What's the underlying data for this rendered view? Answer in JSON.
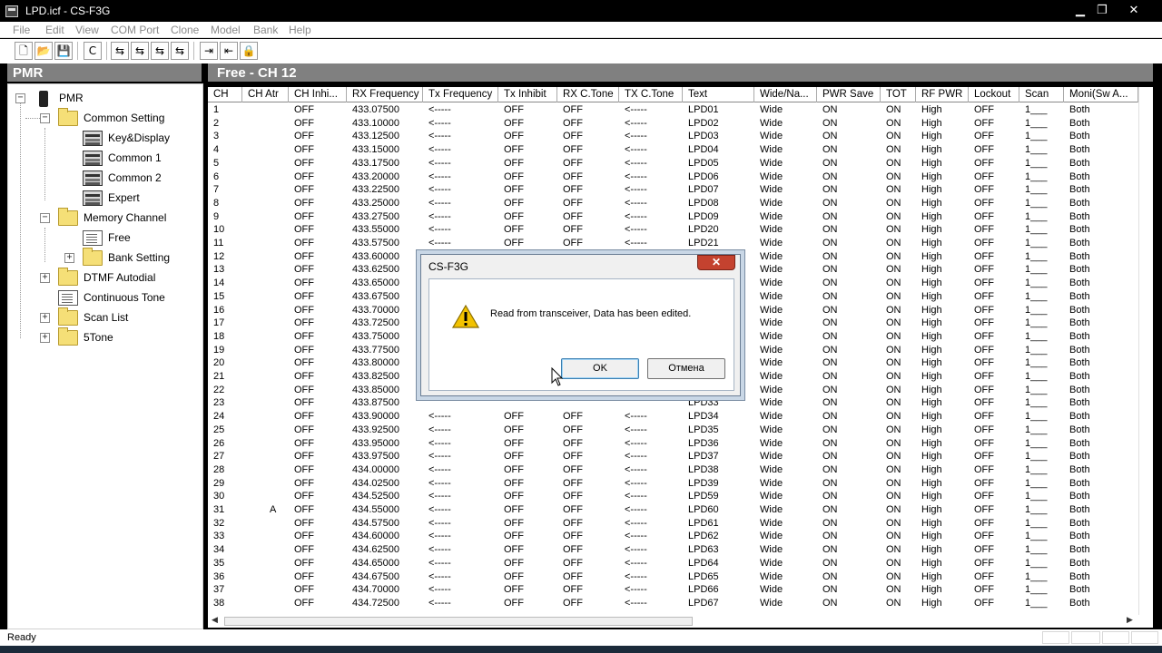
{
  "window": {
    "title": "LPD.icf - CS-F3G",
    "minimize": "▁",
    "maximize": "❐",
    "close": "✕"
  },
  "menu": [
    "File",
    "Edit",
    "View",
    "COM Port",
    "Clone",
    "Model",
    "Bank",
    "Help"
  ],
  "left_panel": {
    "header": "PMR",
    "tree": [
      {
        "label": "PMR",
        "icon": "radio-icon"
      },
      {
        "label": "Common Setting",
        "icon": "folder-icon",
        "expander": "−"
      },
      {
        "label": "Key&Display",
        "icon": "screen-icon"
      },
      {
        "label": "Common 1",
        "icon": "screen-icon"
      },
      {
        "label": "Common 2",
        "icon": "screen-icon"
      },
      {
        "label": "Expert",
        "icon": "screen-icon"
      },
      {
        "label": "Memory Channel",
        "icon": "folder-icon",
        "expander": "−"
      },
      {
        "label": "Free",
        "icon": "document-icon"
      },
      {
        "label": "Bank Setting",
        "icon": "folder-icon",
        "expander": "+"
      },
      {
        "label": "DTMF Autodial",
        "icon": "folder-icon",
        "expander": "+"
      },
      {
        "label": "Continuous Tone",
        "icon": "document-icon"
      },
      {
        "label": "Scan List",
        "icon": "folder-icon",
        "expander": "+"
      },
      {
        "label": "5Tone",
        "icon": "folder-icon",
        "expander": "+"
      }
    ]
  },
  "main": {
    "header": "Free - CH 12",
    "columns": [
      "CH",
      "CH Atr",
      "CH Inhi...",
      "RX Frequency",
      "Tx Frequency",
      "Tx Inhibit",
      "RX C.Tone",
      "TX C.Tone",
      "Text",
      "Wide/Na...",
      "PWR Save",
      "TOT",
      "RF PWR",
      "Lockout",
      "Scan",
      "Moni(Sw A..."
    ],
    "rows": [
      [
        "1",
        "",
        "OFF",
        "433.07500",
        "<-----",
        "OFF",
        "OFF",
        "<-----",
        "LPD01",
        "Wide",
        "ON",
        "ON",
        "High",
        "OFF",
        "1___",
        "Both"
      ],
      [
        "2",
        "",
        "OFF",
        "433.10000",
        "<-----",
        "OFF",
        "OFF",
        "<-----",
        "LPD02",
        "Wide",
        "ON",
        "ON",
        "High",
        "OFF",
        "1___",
        "Both"
      ],
      [
        "3",
        "",
        "OFF",
        "433.12500",
        "<-----",
        "OFF",
        "OFF",
        "<-----",
        "LPD03",
        "Wide",
        "ON",
        "ON",
        "High",
        "OFF",
        "1___",
        "Both"
      ],
      [
        "4",
        "",
        "OFF",
        "433.15000",
        "<-----",
        "OFF",
        "OFF",
        "<-----",
        "LPD04",
        "Wide",
        "ON",
        "ON",
        "High",
        "OFF",
        "1___",
        "Both"
      ],
      [
        "5",
        "",
        "OFF",
        "433.17500",
        "<-----",
        "OFF",
        "OFF",
        "<-----",
        "LPD05",
        "Wide",
        "ON",
        "ON",
        "High",
        "OFF",
        "1___",
        "Both"
      ],
      [
        "6",
        "",
        "OFF",
        "433.20000",
        "<-----",
        "OFF",
        "OFF",
        "<-----",
        "LPD06",
        "Wide",
        "ON",
        "ON",
        "High",
        "OFF",
        "1___",
        "Both"
      ],
      [
        "7",
        "",
        "OFF",
        "433.22500",
        "<-----",
        "OFF",
        "OFF",
        "<-----",
        "LPD07",
        "Wide",
        "ON",
        "ON",
        "High",
        "OFF",
        "1___",
        "Both"
      ],
      [
        "8",
        "",
        "OFF",
        "433.25000",
        "<-----",
        "OFF",
        "OFF",
        "<-----",
        "LPD08",
        "Wide",
        "ON",
        "ON",
        "High",
        "OFF",
        "1___",
        "Both"
      ],
      [
        "9",
        "",
        "OFF",
        "433.27500",
        "<-----",
        "OFF",
        "OFF",
        "<-----",
        "LPD09",
        "Wide",
        "ON",
        "ON",
        "High",
        "OFF",
        "1___",
        "Both"
      ],
      [
        "10",
        "",
        "OFF",
        "433.55000",
        "<-----",
        "OFF",
        "OFF",
        "<-----",
        "LPD20",
        "Wide",
        "ON",
        "ON",
        "High",
        "OFF",
        "1___",
        "Both"
      ],
      [
        "11",
        "",
        "OFF",
        "433.57500",
        "<-----",
        "OFF",
        "OFF",
        "<-----",
        "LPD21",
        "Wide",
        "ON",
        "ON",
        "High",
        "OFF",
        "1___",
        "Both"
      ],
      [
        "12",
        "",
        "OFF",
        "433.60000",
        "",
        "",
        "",
        "",
        "",
        "Wide",
        "ON",
        "ON",
        "High",
        "OFF",
        "1___",
        "Both"
      ],
      [
        "13",
        "",
        "OFF",
        "433.62500",
        "",
        "",
        "",
        "",
        "",
        "Wide",
        "ON",
        "ON",
        "High",
        "OFF",
        "1___",
        "Both"
      ],
      [
        "14",
        "",
        "OFF",
        "433.65000",
        "",
        "",
        "",
        "",
        "",
        "Wide",
        "ON",
        "ON",
        "High",
        "OFF",
        "1___",
        "Both"
      ],
      [
        "15",
        "",
        "OFF",
        "433.67500",
        "",
        "",
        "",
        "",
        "",
        "Wide",
        "ON",
        "ON",
        "High",
        "OFF",
        "1___",
        "Both"
      ],
      [
        "16",
        "",
        "OFF",
        "433.70000",
        "",
        "",
        "",
        "",
        "",
        "Wide",
        "ON",
        "ON",
        "High",
        "OFF",
        "1___",
        "Both"
      ],
      [
        "17",
        "",
        "OFF",
        "433.72500",
        "",
        "",
        "",
        "",
        "",
        "Wide",
        "ON",
        "ON",
        "High",
        "OFF",
        "1___",
        "Both"
      ],
      [
        "18",
        "",
        "OFF",
        "433.75000",
        "",
        "",
        "",
        "",
        "",
        "Wide",
        "ON",
        "ON",
        "High",
        "OFF",
        "1___",
        "Both"
      ],
      [
        "19",
        "",
        "OFF",
        "433.77500",
        "",
        "",
        "",
        "",
        "",
        "Wide",
        "ON",
        "ON",
        "High",
        "OFF",
        "1___",
        "Both"
      ],
      [
        "20",
        "",
        "OFF",
        "433.80000",
        "",
        "",
        "",
        "",
        "",
        "Wide",
        "ON",
        "ON",
        "High",
        "OFF",
        "1___",
        "Both"
      ],
      [
        "21",
        "",
        "OFF",
        "433.82500",
        "",
        "",
        "",
        "",
        "",
        "Wide",
        "ON",
        "ON",
        "High",
        "OFF",
        "1___",
        "Both"
      ],
      [
        "22",
        "",
        "OFF",
        "433.85000",
        "",
        "",
        "",
        "",
        "",
        "Wide",
        "ON",
        "ON",
        "High",
        "OFF",
        "1___",
        "Both"
      ],
      [
        "23",
        "",
        "OFF",
        "433.87500",
        "",
        "",
        "",
        "",
        "LPD33",
        "Wide",
        "ON",
        "ON",
        "High",
        "OFF",
        "1___",
        "Both"
      ],
      [
        "24",
        "",
        "OFF",
        "433.90000",
        "<-----",
        "OFF",
        "OFF",
        "<-----",
        "LPD34",
        "Wide",
        "ON",
        "ON",
        "High",
        "OFF",
        "1___",
        "Both"
      ],
      [
        "25",
        "",
        "OFF",
        "433.92500",
        "<-----",
        "OFF",
        "OFF",
        "<-----",
        "LPD35",
        "Wide",
        "ON",
        "ON",
        "High",
        "OFF",
        "1___",
        "Both"
      ],
      [
        "26",
        "",
        "OFF",
        "433.95000",
        "<-----",
        "OFF",
        "OFF",
        "<-----",
        "LPD36",
        "Wide",
        "ON",
        "ON",
        "High",
        "OFF",
        "1___",
        "Both"
      ],
      [
        "27",
        "",
        "OFF",
        "433.97500",
        "<-----",
        "OFF",
        "OFF",
        "<-----",
        "LPD37",
        "Wide",
        "ON",
        "ON",
        "High",
        "OFF",
        "1___",
        "Both"
      ],
      [
        "28",
        "",
        "OFF",
        "434.00000",
        "<-----",
        "OFF",
        "OFF",
        "<-----",
        "LPD38",
        "Wide",
        "ON",
        "ON",
        "High",
        "OFF",
        "1___",
        "Both"
      ],
      [
        "29",
        "",
        "OFF",
        "434.02500",
        "<-----",
        "OFF",
        "OFF",
        "<-----",
        "LPD39",
        "Wide",
        "ON",
        "ON",
        "High",
        "OFF",
        "1___",
        "Both"
      ],
      [
        "30",
        "",
        "OFF",
        "434.52500",
        "<-----",
        "OFF",
        "OFF",
        "<-----",
        "LPD59",
        "Wide",
        "ON",
        "ON",
        "High",
        "OFF",
        "1___",
        "Both"
      ],
      [
        "31",
        "A",
        "OFF",
        "434.55000",
        "<-----",
        "OFF",
        "OFF",
        "<-----",
        "LPD60",
        "Wide",
        "ON",
        "ON",
        "High",
        "OFF",
        "1___",
        "Both"
      ],
      [
        "32",
        "",
        "OFF",
        "434.57500",
        "<-----",
        "OFF",
        "OFF",
        "<-----",
        "LPD61",
        "Wide",
        "ON",
        "ON",
        "High",
        "OFF",
        "1___",
        "Both"
      ],
      [
        "33",
        "",
        "OFF",
        "434.60000",
        "<-----",
        "OFF",
        "OFF",
        "<-----",
        "LPD62",
        "Wide",
        "ON",
        "ON",
        "High",
        "OFF",
        "1___",
        "Both"
      ],
      [
        "34",
        "",
        "OFF",
        "434.62500",
        "<-----",
        "OFF",
        "OFF",
        "<-----",
        "LPD63",
        "Wide",
        "ON",
        "ON",
        "High",
        "OFF",
        "1___",
        "Both"
      ],
      [
        "35",
        "",
        "OFF",
        "434.65000",
        "<-----",
        "OFF",
        "OFF",
        "<-----",
        "LPD64",
        "Wide",
        "ON",
        "ON",
        "High",
        "OFF",
        "1___",
        "Both"
      ],
      [
        "36",
        "",
        "OFF",
        "434.67500",
        "<-----",
        "OFF",
        "OFF",
        "<-----",
        "LPD65",
        "Wide",
        "ON",
        "ON",
        "High",
        "OFF",
        "1___",
        "Both"
      ],
      [
        "37",
        "",
        "OFF",
        "434.70000",
        "<-----",
        "OFF",
        "OFF",
        "<-----",
        "LPD66",
        "Wide",
        "ON",
        "ON",
        "High",
        "OFF",
        "1___",
        "Both"
      ],
      [
        "38",
        "",
        "OFF",
        "434.72500",
        "<-----",
        "OFF",
        "OFF",
        "<-----",
        "LPD67",
        "Wide",
        "ON",
        "ON",
        "High",
        "OFF",
        "1___",
        "Both"
      ]
    ]
  },
  "dialog": {
    "title": "CS-F3G",
    "close": "✕",
    "message": "Read from transceiver, Data has been edited.",
    "ok_label": "OK",
    "cancel_label": "Отмена"
  },
  "status": {
    "text": "Ready"
  },
  "colors": {
    "panel_header": "#808080",
    "warning": "#f2c200",
    "close_red": "#c4422f"
  }
}
